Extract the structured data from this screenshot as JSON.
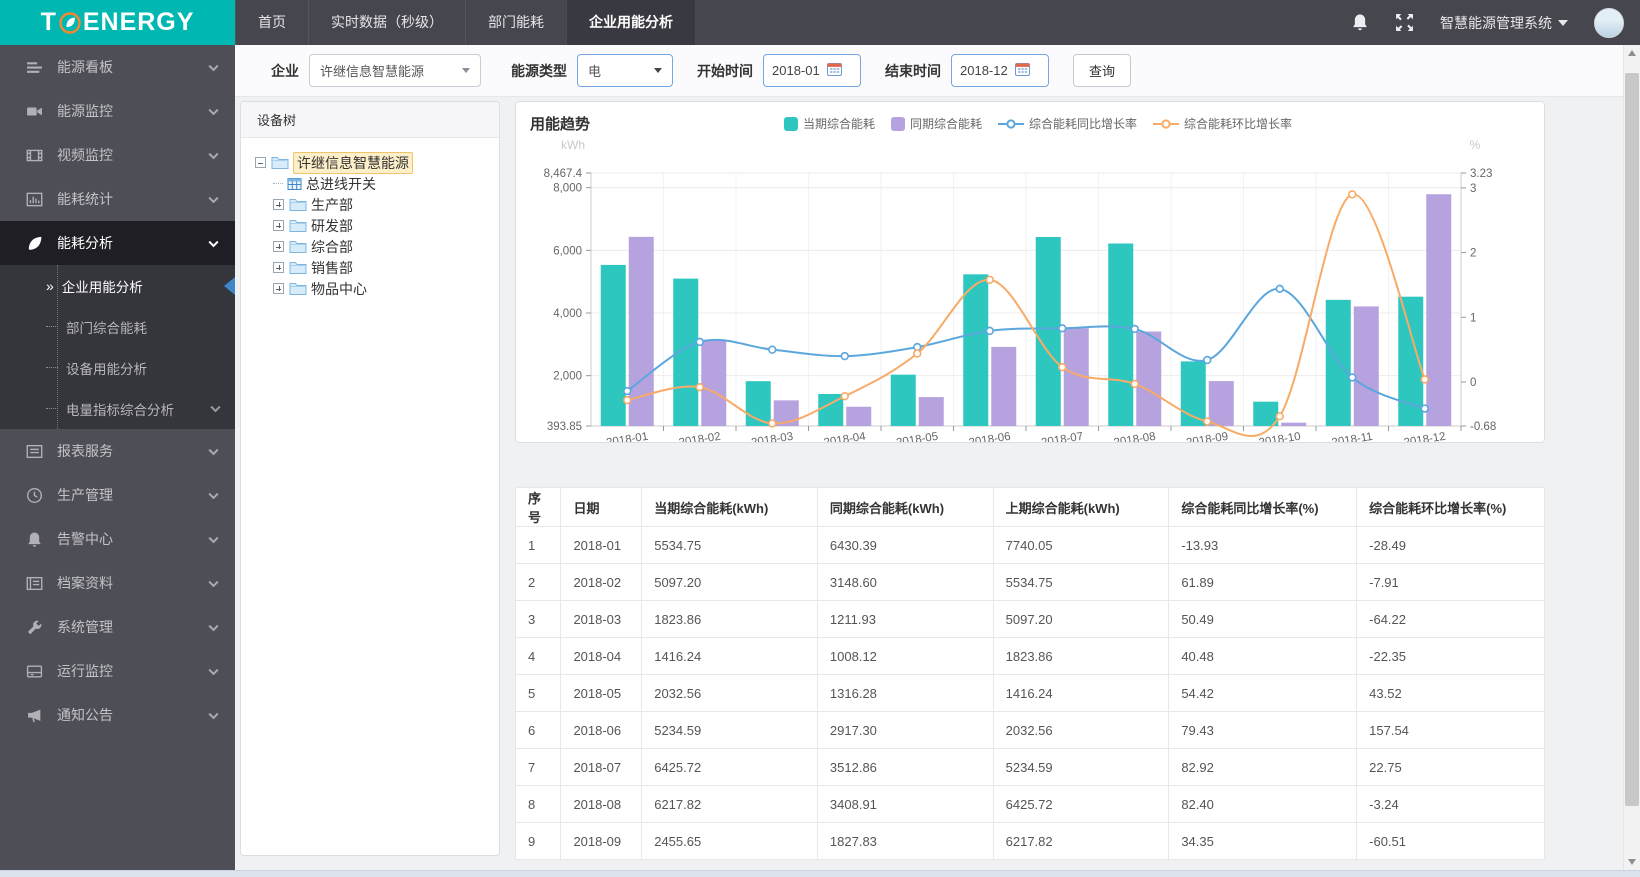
{
  "brand": {
    "logo_prefix": "T",
    "logo_suffix": "ENERGY"
  },
  "top_nav": {
    "tabs": [
      {
        "label": "首页",
        "active": false
      },
      {
        "label": "实时数据（秒级）",
        "active": false
      },
      {
        "label": "部门能耗",
        "active": false
      },
      {
        "label": "企业用能分析",
        "active": true
      }
    ],
    "system_name": "智慧能源管理系统"
  },
  "sidebar": {
    "items": [
      {
        "label": "能源看板",
        "icon": "dashboard",
        "active": false
      },
      {
        "label": "能源监控",
        "icon": "camera",
        "active": false
      },
      {
        "label": "视频监控",
        "icon": "film",
        "active": false
      },
      {
        "label": "能耗统计",
        "icon": "bar-chart",
        "active": false
      },
      {
        "label": "能耗分析",
        "icon": "leaf",
        "active": true,
        "expanded": true,
        "children": [
          {
            "label": "企业用能分析",
            "active": true
          },
          {
            "label": "部门综合能耗",
            "active": false
          },
          {
            "label": "设备用能分析",
            "active": false
          },
          {
            "label": "电量指标综合分析",
            "active": false,
            "has_children": true
          }
        ]
      },
      {
        "label": "报表服务",
        "icon": "report",
        "active": false
      },
      {
        "label": "生产管理",
        "icon": "gauge",
        "active": false
      },
      {
        "label": "告警中心",
        "icon": "bell",
        "active": false
      },
      {
        "label": "档案资料",
        "icon": "archive",
        "active": false
      },
      {
        "label": "系统管理",
        "icon": "wrench",
        "active": false
      },
      {
        "label": "运行监控",
        "icon": "server",
        "active": false
      },
      {
        "label": "通知公告",
        "icon": "megaphone",
        "active": false
      }
    ]
  },
  "filters": {
    "company_label": "企业",
    "company_value": "许继信息智慧能源",
    "energy_type_label": "能源类型",
    "energy_type_value": "电",
    "start_label": "开始时间",
    "start_value": "2018-01",
    "end_label": "结束时间",
    "end_value": "2018-12",
    "search_label": "查询"
  },
  "tree": {
    "title": "设备树",
    "root": "许继信息智慧能源",
    "leaf": "总进线开关",
    "folders": [
      "生产部",
      "研发部",
      "综合部",
      "销售部",
      "物品中心"
    ]
  },
  "chart_data": {
    "type": "bar+line",
    "title": "用能趋势",
    "categories": [
      "2018-01",
      "2018-02",
      "2018-03",
      "2018-04",
      "2018-05",
      "2018-06",
      "2018-07",
      "2018-08",
      "2018-09",
      "2018-10",
      "2018-11",
      "2018-12"
    ],
    "series": [
      {
        "name": "当期综合能耗",
        "type": "bar",
        "axis": "left",
        "color": "#2ec7c0",
        "values": [
          5534.75,
          5097.2,
          1823.86,
          1416.24,
          2032.56,
          5234.59,
          6425.72,
          6217.82,
          2455.65,
          1170,
          4420,
          4520
        ]
      },
      {
        "name": "同期综合能耗",
        "type": "bar",
        "axis": "left",
        "color": "#b6a2de",
        "values": [
          6430.39,
          3148.6,
          1211.93,
          1008.12,
          1316.28,
          2917.3,
          3512.86,
          3408.91,
          1827.83,
          500,
          4210,
          7790
        ]
      },
      {
        "name": "综合能耗同比增长率",
        "type": "line",
        "axis": "right",
        "color": "#5ba7dd",
        "values": [
          -0.14,
          0.62,
          0.5,
          0.4,
          0.54,
          0.79,
          0.83,
          0.82,
          0.34,
          1.44,
          0.07,
          -0.41
        ]
      },
      {
        "name": "综合能耗环比增长率",
        "type": "line",
        "axis": "right",
        "color": "#f8ab67",
        "values": [
          -0.28,
          -0.08,
          -0.64,
          -0.22,
          0.44,
          1.58,
          0.23,
          -0.03,
          -0.61,
          -0.53,
          2.9,
          0.04
        ]
      }
    ],
    "left_axis": {
      "label": "kWh",
      "min": 393.85,
      "max": 8467.4,
      "tick_values": [
        393.85,
        2000,
        4000,
        6000,
        8000,
        8467.4
      ],
      "ticks": [
        "393.85",
        "2,000",
        "4,000",
        "6,000",
        "8,000",
        "8,467.4"
      ]
    },
    "right_axis": {
      "label": "%",
      "min": -0.68,
      "max": 3.23,
      "tick_values": [
        -0.68,
        0,
        1,
        2,
        3,
        3.23
      ],
      "ticks": [
        "-0.68",
        "0",
        "1",
        "2",
        "3",
        "3.23"
      ]
    },
    "grid": true,
    "legend_position": "top"
  },
  "table": {
    "columns": [
      "序号",
      "日期",
      "当期综合能耗(kWh)",
      "同期综合能耗(kWh)",
      "上期综合能耗(kWh)",
      "综合能耗同比增长率(%)",
      "综合能耗环比增长率(%)"
    ],
    "rows": [
      [
        "1",
        "2018-01",
        "5534.75",
        "6430.39",
        "7740.05",
        "-13.93",
        "-28.49"
      ],
      [
        "2",
        "2018-02",
        "5097.20",
        "3148.60",
        "5534.75",
        "61.89",
        "-7.91"
      ],
      [
        "3",
        "2018-03",
        "1823.86",
        "1211.93",
        "5097.20",
        "50.49",
        "-64.22"
      ],
      [
        "4",
        "2018-04",
        "1416.24",
        "1008.12",
        "1823.86",
        "40.48",
        "-22.35"
      ],
      [
        "5",
        "2018-05",
        "2032.56",
        "1316.28",
        "1416.24",
        "54.42",
        "43.52"
      ],
      [
        "6",
        "2018-06",
        "5234.59",
        "2917.30",
        "2032.56",
        "79.43",
        "157.54"
      ],
      [
        "7",
        "2018-07",
        "6425.72",
        "3512.86",
        "5234.59",
        "82.92",
        "22.75"
      ],
      [
        "8",
        "2018-08",
        "6217.82",
        "3408.91",
        "6425.72",
        "82.40",
        "-3.24"
      ],
      [
        "9",
        "2018-09",
        "2455.65",
        "1827.83",
        "6217.82",
        "34.35",
        "-60.51"
      ]
    ]
  },
  "colors": {
    "brand_teal": "#00b7b1",
    "bar_current": "#2ec7c0",
    "bar_same_period": "#b6a2de",
    "line_yoy": "#5ba7dd",
    "line_mom": "#f8ab67",
    "tree_highlight": "#fdf0c8"
  }
}
